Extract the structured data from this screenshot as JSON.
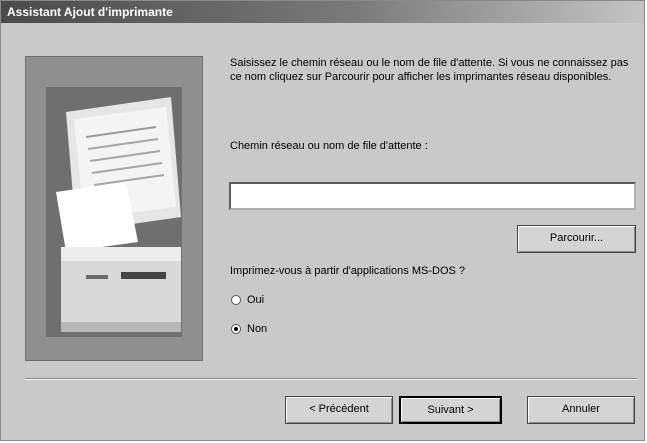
{
  "window": {
    "title": "Assistant Ajout d'imprimante"
  },
  "main": {
    "intro": "Saisissez le chemin réseau ou le nom de file d'attente. Si vous ne connaissez pas ce nom cliquez sur Parcourir pour afficher les imprimantes réseau disponibles.",
    "path_label": "Chemin réseau ou nom de file d'attente :",
    "path_value": "",
    "browse_label": "Parcourir...",
    "dos_question": "Imprimez-vous à partir d'applications MS-DOS ?",
    "option_yes": "Oui",
    "option_no": "Non",
    "selected": "Non"
  },
  "footer": {
    "back_label": "< Précédent",
    "next_label": "Suivant >",
    "cancel_label": "Annuler"
  }
}
